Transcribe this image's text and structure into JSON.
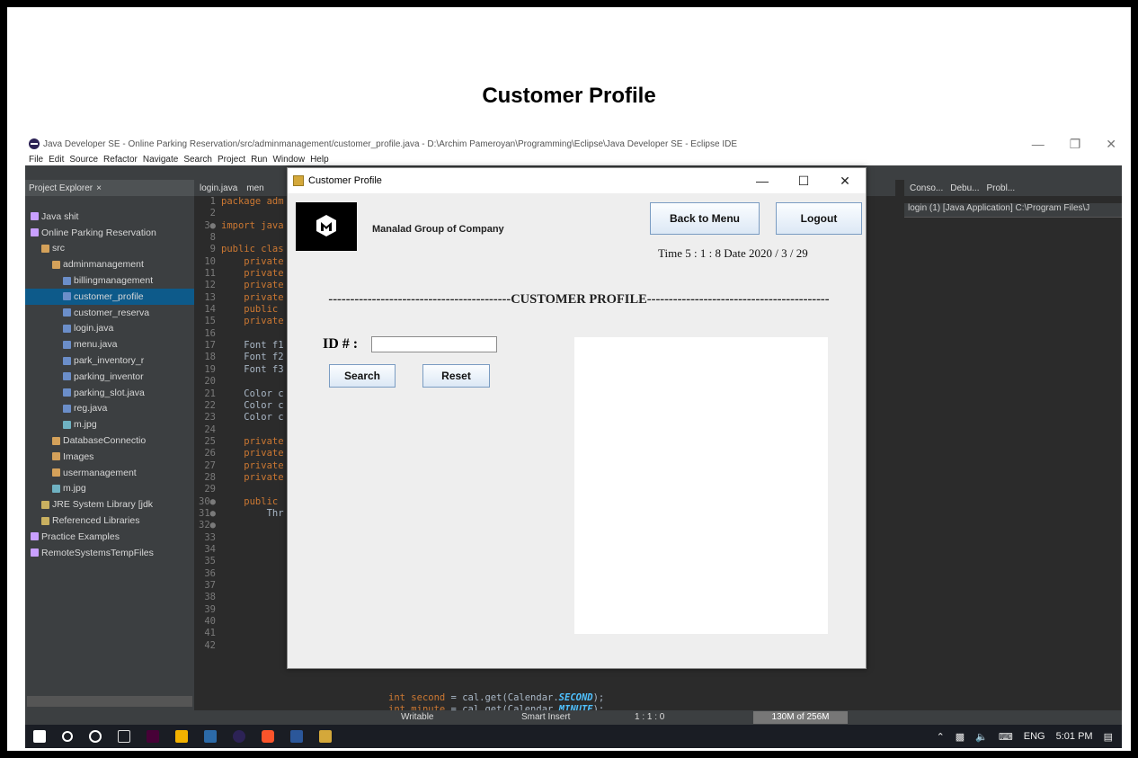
{
  "slide": {
    "title": "Customer Profile"
  },
  "ide": {
    "title": "Java Developer SE - Online Parking Reservation/src/adminmanagement/customer_profile.java - D:\\Archim Pameroyan\\Programming\\Eclipse\\Java Developer SE - Eclipse IDE",
    "menu": [
      "File",
      "Edit",
      "Source",
      "Refactor",
      "Navigate",
      "Search",
      "Project",
      "Run",
      "Window",
      "Help"
    ],
    "explorer": {
      "title": "Project Explorer",
      "items": [
        {
          "label": "Java shit",
          "indent": 0,
          "color": "#c9a0ff"
        },
        {
          "label": "Online Parking Reservation",
          "indent": 0,
          "color": "#c9a0ff"
        },
        {
          "label": "src",
          "indent": 1,
          "color": "#d4a15a"
        },
        {
          "label": "adminmanagement",
          "indent": 2,
          "color": "#d4a15a"
        },
        {
          "label": "billingmanagement",
          "indent": 3,
          "color": "#6b8ec9"
        },
        {
          "label": "customer_profile",
          "indent": 3,
          "color": "#6b8ec9",
          "selected": true
        },
        {
          "label": "customer_reserva",
          "indent": 3,
          "color": "#6b8ec9"
        },
        {
          "label": "login.java",
          "indent": 3,
          "color": "#6b8ec9"
        },
        {
          "label": "menu.java",
          "indent": 3,
          "color": "#6b8ec9"
        },
        {
          "label": "park_inventory_r",
          "indent": 3,
          "color": "#6b8ec9"
        },
        {
          "label": "parking_inventor",
          "indent": 3,
          "color": "#6b8ec9"
        },
        {
          "label": "parking_slot.java",
          "indent": 3,
          "color": "#6b8ec9"
        },
        {
          "label": "reg.java",
          "indent": 3,
          "color": "#6b8ec9"
        },
        {
          "label": "m.jpg",
          "indent": 3,
          "color": "#6fb2c2"
        },
        {
          "label": "DatabaseConnectio",
          "indent": 2,
          "color": "#d4a15a"
        },
        {
          "label": "Images",
          "indent": 2,
          "color": "#d4a15a"
        },
        {
          "label": "usermanagement",
          "indent": 2,
          "color": "#d4a15a"
        },
        {
          "label": "m.jpg",
          "indent": 2,
          "color": "#6fb2c2"
        },
        {
          "label": "JRE System Library [jdk",
          "indent": 1,
          "color": "#c9b060"
        },
        {
          "label": "Referenced Libraries",
          "indent": 1,
          "color": "#c9b060"
        },
        {
          "label": "Practice Examples",
          "indent": 0,
          "color": "#c9a0ff"
        },
        {
          "label": "RemoteSystemsTempFiles",
          "indent": 0,
          "color": "#c9a0ff"
        }
      ]
    },
    "editor_tabs": [
      "login.java",
      "men"
    ],
    "code_lines": [
      {
        "n": "1",
        "t": "package adm",
        "k": true
      },
      {
        "n": "2",
        "t": ""
      },
      {
        "n": "3●",
        "t": "import java",
        "k": true
      },
      {
        "n": "8",
        "t": ""
      },
      {
        "n": "9",
        "t": "public clas",
        "k": true
      },
      {
        "n": "10",
        "t": "    private",
        "k": true
      },
      {
        "n": "11",
        "t": "    private",
        "k": true
      },
      {
        "n": "12",
        "t": "    private",
        "k": true
      },
      {
        "n": "13",
        "t": "    private",
        "k": true
      },
      {
        "n": "14",
        "t": "    public ",
        "k": true
      },
      {
        "n": "15",
        "t": "    private",
        "k": true
      },
      {
        "n": "16",
        "t": ""
      },
      {
        "n": "17",
        "t": "    Font f1",
        "k": false
      },
      {
        "n": "18",
        "t": "    Font f2",
        "k": false
      },
      {
        "n": "19",
        "t": "    Font f3",
        "k": false
      },
      {
        "n": "20",
        "t": ""
      },
      {
        "n": "21",
        "t": "    Color c",
        "k": false
      },
      {
        "n": "22",
        "t": "    Color c",
        "k": false
      },
      {
        "n": "23",
        "t": "    Color c",
        "k": false
      },
      {
        "n": "24",
        "t": ""
      },
      {
        "n": "25",
        "t": "    private",
        "k": true
      },
      {
        "n": "26",
        "t": "    private",
        "k": true
      },
      {
        "n": "27",
        "t": "    private",
        "k": true
      },
      {
        "n": "28",
        "t": "    private",
        "k": true
      },
      {
        "n": "29",
        "t": ""
      },
      {
        "n": "30●",
        "t": "    public ",
        "k": true
      },
      {
        "n": "31●",
        "t": "        Thr",
        "k": false
      },
      {
        "n": "32●",
        "t": ""
      },
      {
        "n": "33",
        "t": ""
      },
      {
        "n": "34",
        "t": ""
      },
      {
        "n": "35",
        "t": ""
      },
      {
        "n": "36",
        "t": ""
      },
      {
        "n": "37",
        "t": ""
      },
      {
        "n": "38",
        "t": ""
      },
      {
        "n": "39",
        "t": ""
      },
      {
        "n": "40",
        "t": ""
      },
      {
        "n": "41",
        "t": ""
      },
      {
        "n": "42",
        "t": ""
      }
    ],
    "code_bottom": [
      {
        "pre": "int ",
        "var": "second",
        "mid": " = cal.get(Calendar.",
        "cls": "SECOND",
        "end": ");"
      },
      {
        "pre": "int ",
        "var": "minute",
        "mid": " = cal.get(Calendar.",
        "cls": "MINUTE",
        "end": ");"
      }
    ],
    "right_tabs": [
      "Conso...",
      "Debu...",
      "Probl..."
    ],
    "console_info": "login (1) [Java Application] C:\\Program Files\\J",
    "status": {
      "writable": "Writable",
      "insert": "Smart Insert",
      "position": "1 : 1 : 0",
      "heap": "130M of 256M"
    },
    "tray": {
      "language": "ENG",
      "time": "5:01 PM"
    }
  },
  "dialog": {
    "title": "Customer Profile",
    "company": "Manalad Group of Company",
    "back_label": "Back to Menu",
    "logout_label": "Logout",
    "time_text": "Time 5 : 1 : 8 Date 2020 / 3 / 29",
    "divider_text": "------------------------------------------CUSTOMER PROFILE------------------------------------------",
    "id_label": "ID # :",
    "id_value": "",
    "search_label": "Search",
    "reset_label": "Reset"
  },
  "colors": {
    "ide_bg": "#2b2b2b",
    "panel_bg": "#3c3f41",
    "selection": "#0d5a8a",
    "keyword": "#cc7832",
    "button_border": "#7a9cc2",
    "dialog_bg": "#eeeeee"
  }
}
